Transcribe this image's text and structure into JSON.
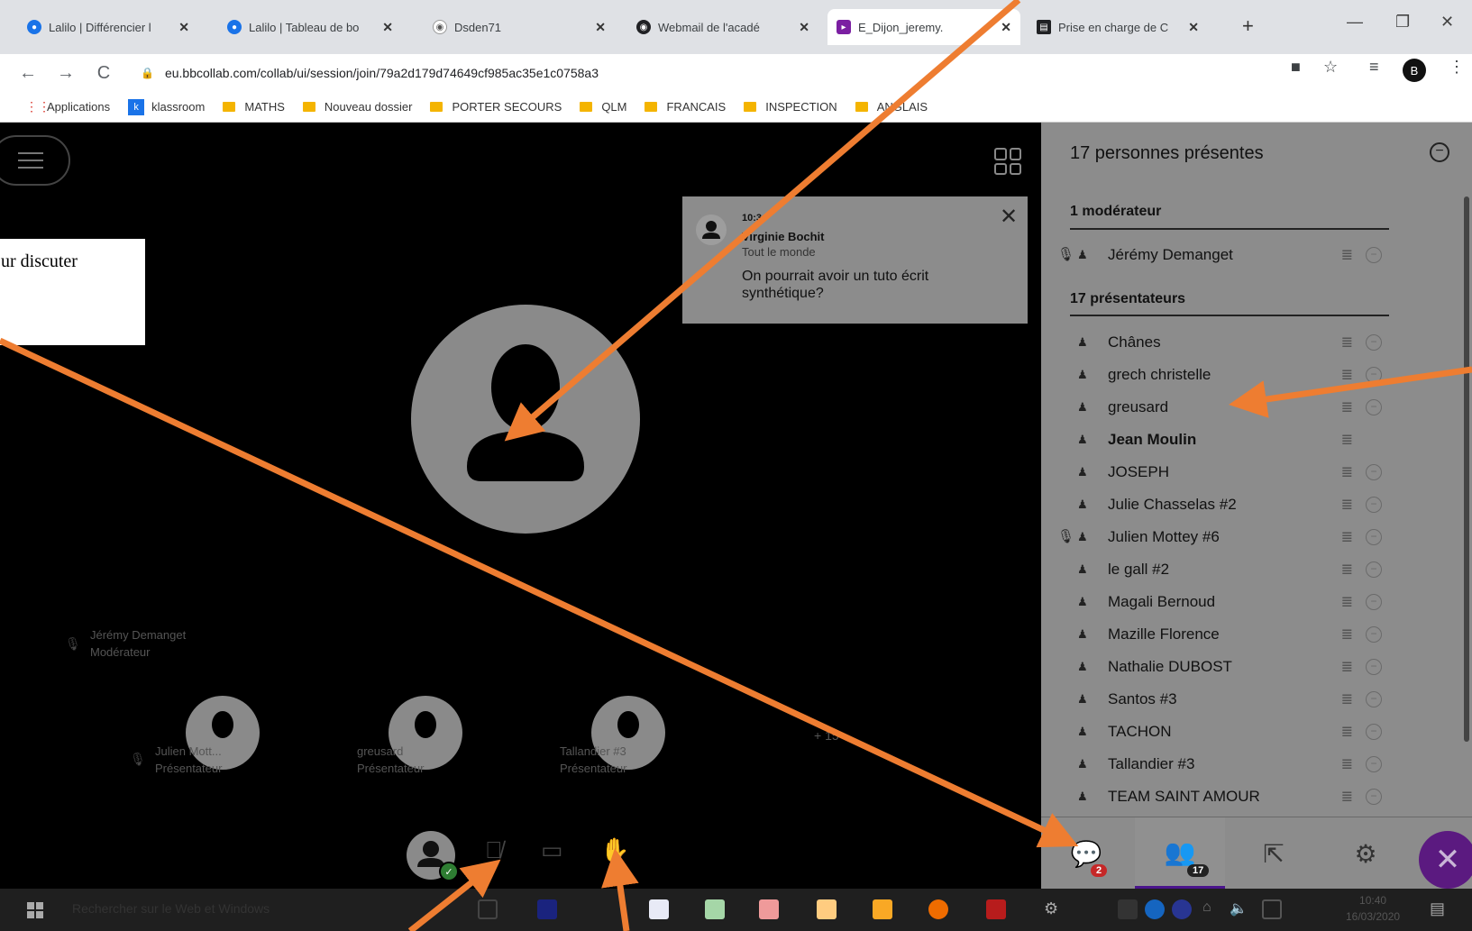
{
  "browser": {
    "tabs": [
      {
        "title": "Lalilo | Différencier l",
        "icon_color": "#1a73e8"
      },
      {
        "title": "Lalilo | Tableau de bo",
        "icon_color": "#1a73e8"
      },
      {
        "title": "Dsden71",
        "icon_color": "#5f6368"
      },
      {
        "title": "Webmail de l'acadé",
        "icon_color": "#202124"
      },
      {
        "title": "E_Dijon_jeremy.",
        "icon_color": "#7b1fa2"
      },
      {
        "title": "Prise en charge de C",
        "icon_color": "#202124"
      }
    ],
    "url": "eu.bbcollab.com/collab/ui/session/join/79a2d179d74649cf985ac35e1c0758a3",
    "profile_initial": "B",
    "bookmarks": [
      "Applications",
      "klassroom",
      "MATHS",
      "Nouveau dossier",
      "PORTER SECOURS",
      "QLM",
      "FRANCAIS",
      "INSPECTION",
      "ANGLAIS"
    ]
  },
  "callout_text": "ur discuter",
  "notification": {
    "time": "10:3",
    "sender": "Virginie Bochit",
    "audience": "Tout le monde",
    "message": "On pourrait avoir un tuto écrit synthétique?"
  },
  "stage": {
    "moderator_label": {
      "name": "Jérémy Demanget",
      "role": "Modérateur"
    },
    "tiles": [
      {
        "name": "Julien Mott...",
        "role": "Présentateur"
      },
      {
        "name": "greusard",
        "role": "Présentateur"
      },
      {
        "name": "Tallandier #3",
        "role": "Présentateur"
      }
    ],
    "more_count": "+ 15"
  },
  "panel": {
    "title": "17 personnes présentes",
    "moderators_header": "1 modérateur",
    "moderators": [
      {
        "name": "Jérémy Demanget",
        "mic": true
      }
    ],
    "presenters_header": "17 présentateurs",
    "presenters": [
      {
        "name": "Chânes"
      },
      {
        "name": "grech christelle"
      },
      {
        "name": "greusard"
      },
      {
        "name": "Jean Moulin",
        "bold": true
      },
      {
        "name": "JOSEPH"
      },
      {
        "name": "Julie Chasselas #2"
      },
      {
        "name": "Julien Mottey #6",
        "mic": true
      },
      {
        "name": "le gall #2"
      },
      {
        "name": "Magali Bernoud"
      },
      {
        "name": "Mazille Florence"
      },
      {
        "name": "Nathalie DUBOST"
      },
      {
        "name": "Santos #3"
      },
      {
        "name": "TACHON"
      },
      {
        "name": "Tallandier #3"
      },
      {
        "name": "TEAM SAINT AMOUR"
      }
    ],
    "chat_badge": "2",
    "participants_badge": "17"
  },
  "taskbar": {
    "search_placeholder": "Rechercher sur le Web et Windows",
    "time": "10:40",
    "date": "16/03/2020"
  },
  "colors": {
    "arrow": "#ee7d31",
    "accent": "#5b1a80",
    "chat_badge": "#c62828",
    "stage_bg": "#000000",
    "panel_bg": "#8c8c8c"
  }
}
